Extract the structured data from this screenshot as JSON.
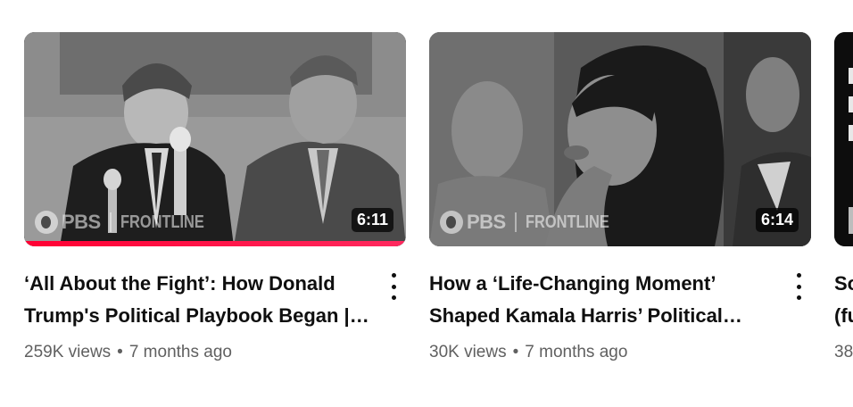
{
  "videos": [
    {
      "title": "‘All About the Fight’: How Donald Trump's Political Playbook Began |…",
      "views": "259K views",
      "age": "7 months ago",
      "duration": "6:11",
      "watermark_network": "PBS",
      "watermark_show": "FRONTLINE",
      "watch_progress": 1.0
    },
    {
      "title": "How a ‘Life-Changing Moment’ Shaped Kamala Harris’ Political…",
      "views": "30K views",
      "age": "7 months ago",
      "duration": "6:14",
      "watermark_network": "PBS",
      "watermark_show": "FRONTLINE",
      "watch_progress": 0
    },
    {
      "title_line1": "So",
      "title_line2": "(fu",
      "meta": "38"
    }
  ],
  "separator": "•",
  "icons": {
    "menu": "more-vert-icon",
    "logo": "pbs-logo-icon"
  }
}
